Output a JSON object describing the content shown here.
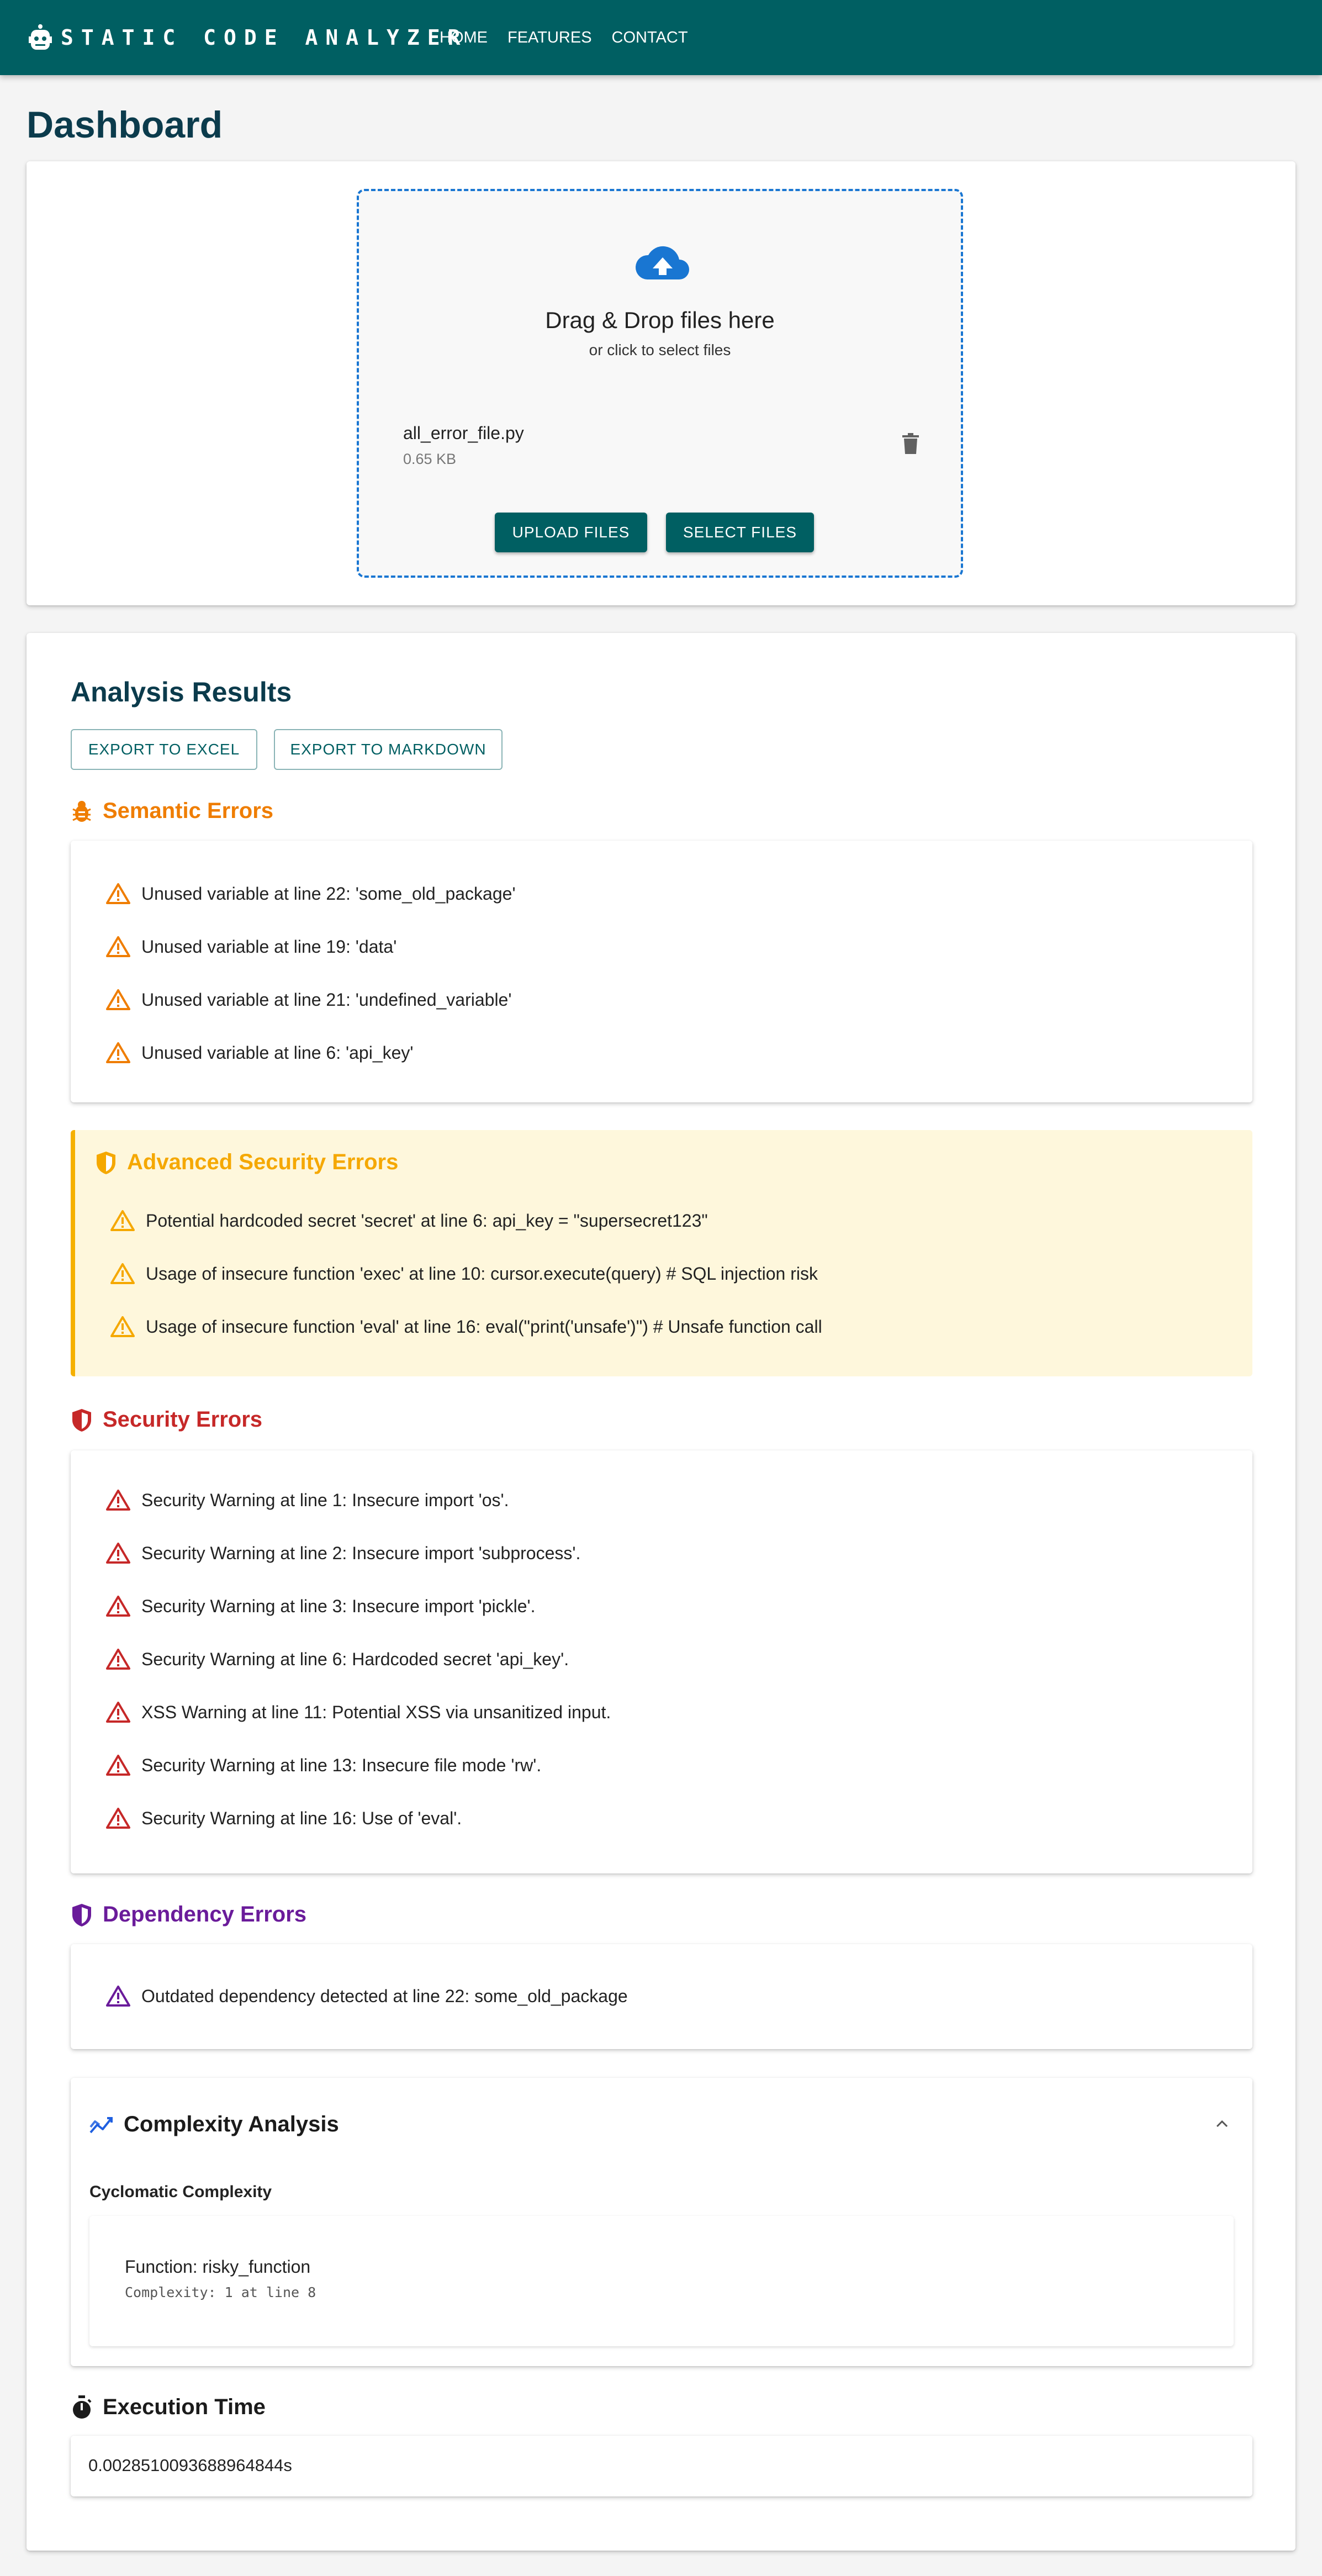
{
  "header": {
    "brand": "STATIC CODE ANALYZER",
    "nav": [
      "HOME",
      "FEATURES",
      "CONTACT"
    ],
    "brand_icon": "robot-icon"
  },
  "page_title": "Dashboard",
  "upload": {
    "drop_title": "Drag & Drop files here",
    "drop_subtitle": "or click to select files",
    "file": {
      "name": "all_error_file.py",
      "size": "0.65 KB"
    },
    "upload_label": "UPLOAD FILES",
    "select_label": "SELECT FILES"
  },
  "results": {
    "title": "Analysis Results",
    "export_excel": "EXPORT TO EXCEL",
    "export_markdown": "EXPORT TO MARKDOWN",
    "semantic": {
      "title": "Semantic Errors",
      "color": "#ef7d00",
      "items": [
        "Unused variable at line 22: 'some_old_package'",
        "Unused variable at line 19: 'data'",
        "Unused variable at line 21: 'undefined_variable'",
        "Unused variable at line 6: 'api_key'"
      ]
    },
    "advanced": {
      "title": "Advanced Security Errors",
      "color": "#f5a800",
      "items": [
        "Potential hardcoded secret 'secret' at line 6: api_key = \"supersecret123\"",
        "Usage of insecure function 'exec' at line 10: cursor.execute(query) # SQL injection risk",
        "Usage of insecure function 'eval' at line 16: eval(\"print('unsafe')\") # Unsafe function call"
      ]
    },
    "security": {
      "title": "Security Errors",
      "color": "#c62828",
      "items": [
        "Security Warning at line 1: Insecure import 'os'.",
        "Security Warning at line 2: Insecure import 'subprocess'.",
        "Security Warning at line 3: Insecure import 'pickle'.",
        "Security Warning at line 6: Hardcoded secret 'api_key'.",
        "XSS Warning at line 11: Potential XSS via unsanitized input.",
        "Security Warning at line 13: Insecure file mode 'rw'.",
        "Security Warning at line 16: Use of 'eval'."
      ]
    },
    "dependency": {
      "title": "Dependency Errors",
      "color": "#6a1b9a",
      "items": [
        "Outdated dependency detected at line 22: some_old_package"
      ]
    },
    "complexity": {
      "title": "Complexity Analysis",
      "subtitle": "Cyclomatic Complexity",
      "function": "Function: risky_function",
      "detail": "Complexity: 1 at line 8"
    },
    "execution": {
      "title": "Execution Time",
      "value": "0.0028510093688964844s"
    }
  }
}
